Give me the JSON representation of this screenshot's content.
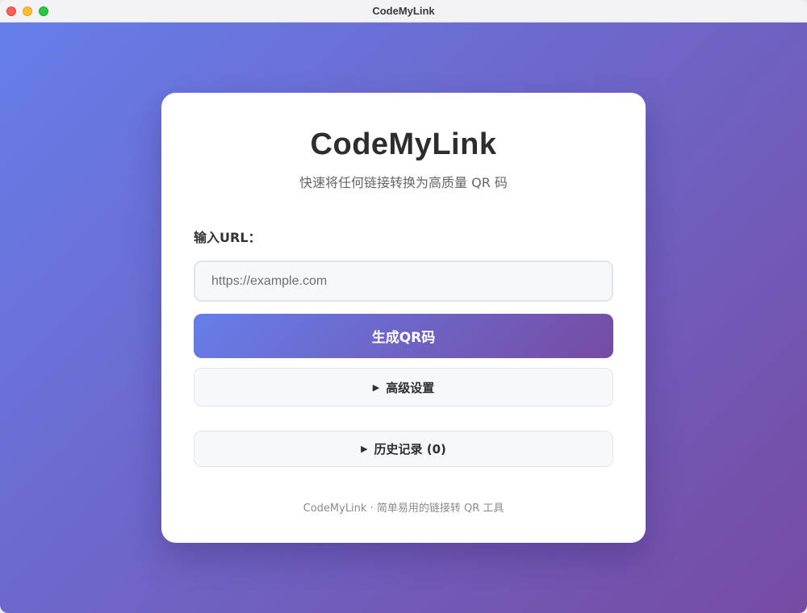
{
  "window": {
    "title": "CodeMyLink"
  },
  "app": {
    "title": "CodeMyLink",
    "subtitle": "快速将任何链接转换为高质量 QR 码"
  },
  "form": {
    "url_label": "输入URL：",
    "url_placeholder": "https://example.com",
    "url_value": "",
    "generate_label": "生成QR码"
  },
  "advanced": {
    "icon": "triangle-right",
    "label": "高级设置"
  },
  "history": {
    "icon": "triangle-right",
    "label": "历史记录 (0)"
  },
  "footer": {
    "text": "CodeMyLink · 简单易用的链接转 QR 工具"
  },
  "colors": {
    "gradient_start": "#667eea",
    "gradient_end": "#764ba2",
    "card_bg": "#ffffff"
  }
}
